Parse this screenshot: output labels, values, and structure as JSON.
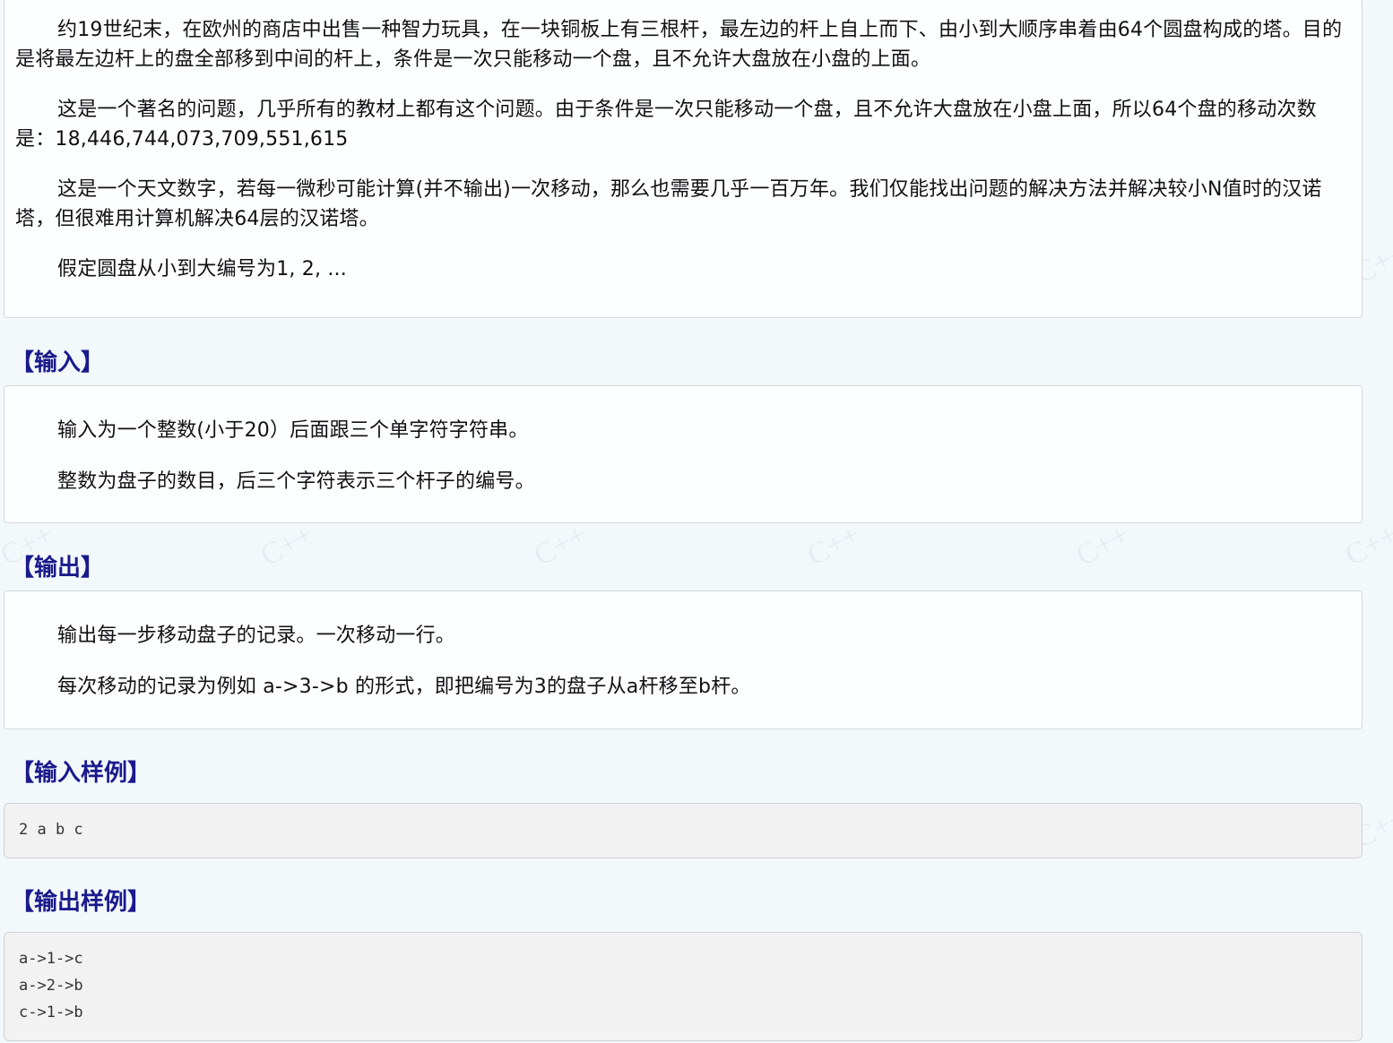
{
  "watermark": {
    "text": "C++"
  },
  "description": {
    "paragraphs": [
      "约19世纪末，在欧州的商店中出售一种智力玩具，在一块铜板上有三根杆，最左边的杆上自上而下、由小到大顺序串着由64个圆盘构成的塔。目的是将最左边杆上的盘全部移到中间的杆上，条件是一次只能移动一个盘，且不允许大盘放在小盘的上面。",
      "这是一个著名的问题，几乎所有的教材上都有这个问题。由于条件是一次只能移动一个盘，且不允许大盘放在小盘上面，所以64个盘的移动次数是：18,446,744,073,709,551,615",
      "这是一个天文数字，若每一微秒可能计算(并不输出)一次移动，那么也需要几乎一百万年。我们仅能找出问题的解决方法并解决较小N值时的汉诺塔，但很难用计算机解决64层的汉诺塔。",
      "假定圆盘从小到大编号为1, 2, ..."
    ]
  },
  "input_section": {
    "title": "【输入】",
    "paragraphs": [
      "输入为一个整数(小于20）后面跟三个单字符字符串。",
      "整数为盘子的数目，后三个字符表示三个杆子的编号。"
    ]
  },
  "output_section": {
    "title": "【输出】",
    "paragraphs": [
      "输出每一步移动盘子的记录。一次移动一行。",
      "每次移动的记录为例如 a->3->b 的形式，即把编号为3的盘子从a杆移至b杆。"
    ]
  },
  "sample_input": {
    "title": "【输入样例】",
    "code": "2 a b c"
  },
  "sample_output": {
    "title": "【输出样例】",
    "lines": [
      "a->1->c",
      "a->2->b",
      "c->1->b"
    ]
  },
  "colors": {
    "title": "#1a1a8c",
    "background": "#f3f9fb",
    "code_background": "#f2f2f2"
  }
}
